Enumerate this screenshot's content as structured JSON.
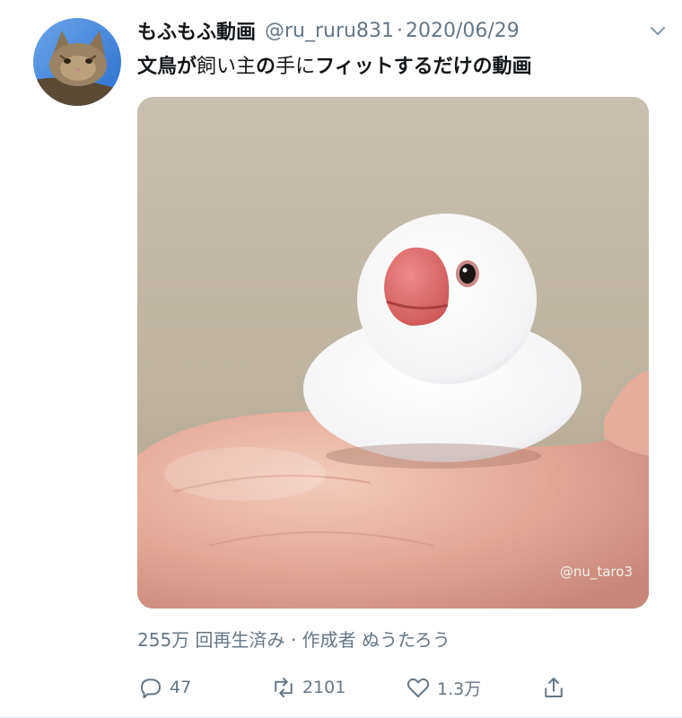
{
  "tweet": {
    "author_name": "もふもふ動画",
    "handle": "@ru_ruru831",
    "separator": "·",
    "date": "2020/06/29",
    "text_parts": [
      "文鳥",
      "が",
      "飼い主",
      "の",
      "手",
      "に",
      "フィットするだけの動画"
    ]
  },
  "media": {
    "watermark": "@nu_taro3"
  },
  "views_line": "255万 回再生済み · 作成者 ぬうたろう",
  "actions": {
    "reply_count": "47",
    "retweet_count": "2101",
    "like_count": "1.3万"
  },
  "colors": {
    "text": "#14171a",
    "secondary": "#657786",
    "border": "#e6ecf0"
  },
  "icons": [
    "chevron-down-icon",
    "reply-icon",
    "retweet-icon",
    "like-icon",
    "share-icon"
  ]
}
